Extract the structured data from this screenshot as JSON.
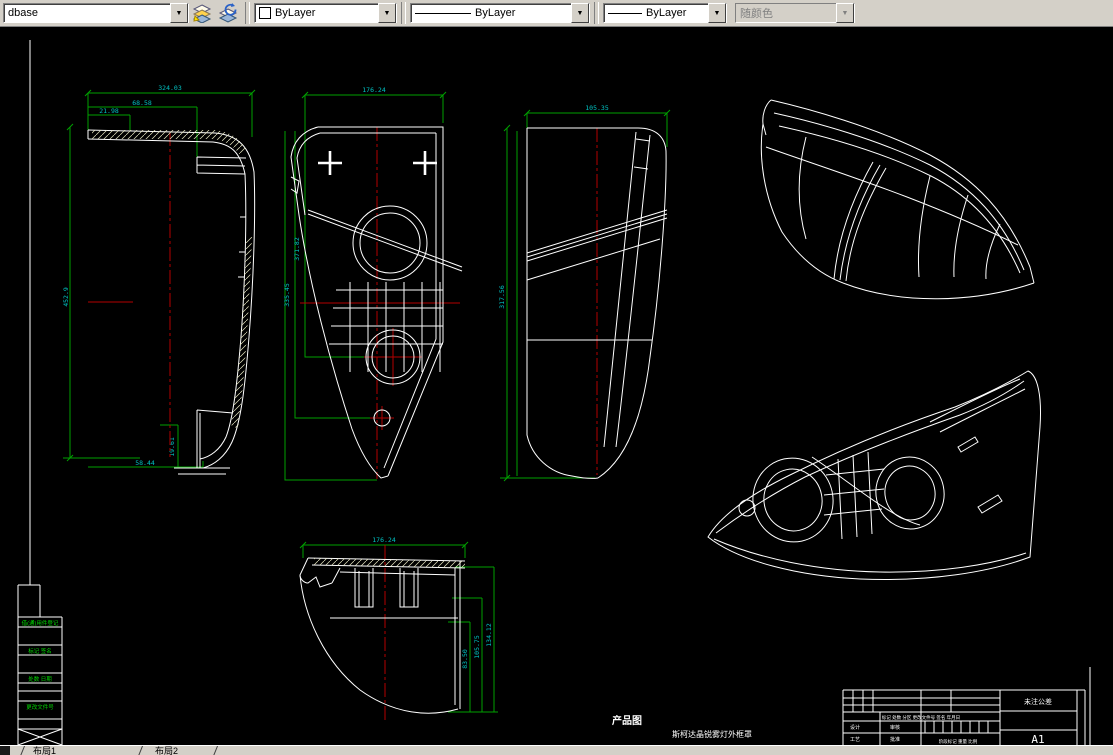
{
  "toolbar": {
    "layer_value": "dbase",
    "color_value": "ByLayer",
    "linetype_value": "ByLayer",
    "lineweight_value": "ByLayer",
    "plot_style_value": "随颜色"
  },
  "dims": {
    "v1_w_total": "324.03",
    "v1_w_mid": "68.58",
    "v1_w_small": "21.98",
    "v1_h": "452.9",
    "v1_bottom": "58.44",
    "v1_foot": "19.61",
    "v2_w": "176.24",
    "v2_h1": "371.82",
    "v2_h2": "335.45",
    "v3_w": "105.35",
    "v3_h": "317.56",
    "v4_w": "176.24",
    "v4_h_outer": "134.12",
    "v4_h_mid": "105.75",
    "v4_h_inner": "83.50"
  },
  "annotations": {
    "drawing_label": "产品图",
    "part_name": "斯柯达晶锐雾灯外框罩"
  },
  "title_block": {
    "tolerance": "未注公差",
    "sheet": "A1",
    "revision_row": "标记 处数 分区 更改文件号 签名 年月日",
    "designer": "设计",
    "checker": "审核",
    "process": "工艺",
    "approver": "批准",
    "stage_row": "阶段标记 重量 比例"
  },
  "frame_table": {
    "r1": "借(通)用件登记",
    "r2": "标记 签名",
    "r3": "处数 日期",
    "r4": "更改文件号"
  },
  "status_bar": {
    "tab1": "布局1",
    "tab2": "布局2"
  },
  "colors": {
    "dimension": "#00a000",
    "dimension_text": "#00c2c2",
    "centerline": "#b40000",
    "geometry": "#ffffff",
    "frame_text": "#00d800",
    "canvas_bg": "#000000",
    "toolbar_bg": "#d4d0c8"
  }
}
